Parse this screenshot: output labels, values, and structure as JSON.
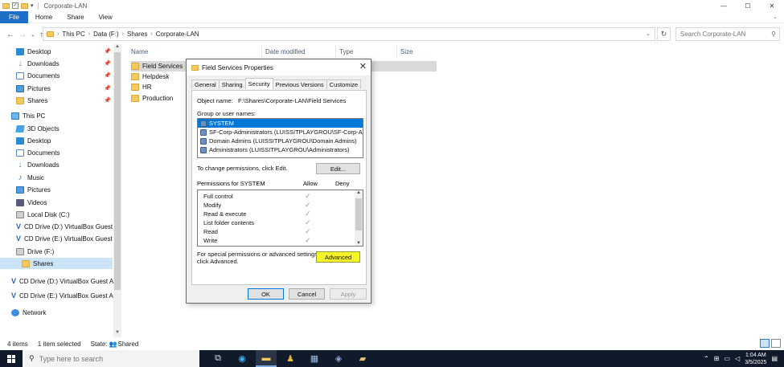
{
  "window": {
    "title": "Corporate-LAN",
    "controls": {
      "minimize": "—",
      "maximize": "☐",
      "close": "✕"
    }
  },
  "ribbon": {
    "tabs": [
      "File",
      "Home",
      "Share",
      "View"
    ],
    "expand_glyph": "⌄"
  },
  "nav_buttons": {
    "back": "←",
    "forward": "→",
    "recent": "⌄",
    "up": "↑"
  },
  "address": {
    "breadcrumbs": [
      "This PC",
      "Data (F:)",
      "Shares",
      "Corporate-LAN"
    ],
    "separator": "›"
  },
  "search": {
    "placeholder": "Search Corporate-LAN"
  },
  "navpane": {
    "quick_access": [
      {
        "label": "Desktop",
        "icon": "desktop-icon",
        "pinned": true
      },
      {
        "label": "Downloads",
        "icon": "downloads-icon",
        "pinned": true
      },
      {
        "label": "Documents",
        "icon": "documents-icon",
        "pinned": true
      },
      {
        "label": "Pictures",
        "icon": "pictures-icon",
        "pinned": true
      },
      {
        "label": "Shares",
        "icon": "folder-icon",
        "pinned": true
      }
    ],
    "this_pc": "This PC",
    "this_pc_items": [
      {
        "label": "3D Objects",
        "icon": "3d-objects-icon"
      },
      {
        "label": "Desktop",
        "icon": "desktop-icon"
      },
      {
        "label": "Documents",
        "icon": "documents-icon"
      },
      {
        "label": "Downloads",
        "icon": "downloads-icon"
      },
      {
        "label": "Music",
        "icon": "music-icon"
      },
      {
        "label": "Pictures",
        "icon": "pictures-icon"
      },
      {
        "label": "Videos",
        "icon": "videos-icon"
      },
      {
        "label": "Local Disk (C:)",
        "icon": "disk-icon"
      },
      {
        "label": "CD Drive (D:) VirtualBox Guest A",
        "icon": "virtualbox-cd-icon"
      },
      {
        "label": "CD Drive (E:) VirtualBox Guest A",
        "icon": "virtualbox-cd-icon"
      },
      {
        "label": "Drive (F:)",
        "icon": "disk-icon"
      },
      {
        "label": "Shares",
        "icon": "folder-icon"
      }
    ],
    "other_items": [
      {
        "label": "CD Drive (D:) VirtualBox Guest Ad",
        "icon": "virtualbox-cd-icon"
      },
      {
        "label": "CD Drive (E:) VirtualBox Guest Ad",
        "icon": "virtualbox-cd-icon"
      },
      {
        "label": "Network",
        "icon": "network-icon"
      }
    ]
  },
  "filelist": {
    "columns": [
      "Name",
      "Date modified",
      "Type",
      "Size"
    ],
    "items": [
      "Field Services",
      "Helpdesk",
      "HR",
      "Production"
    ]
  },
  "statusbar": {
    "items_count": "4 items",
    "selected": "1 item selected",
    "state_label": "State:",
    "state_value": "Shared"
  },
  "dialog": {
    "title": "Field Services Properties",
    "tabs": [
      "General",
      "Sharing",
      "Security",
      "Previous Versions",
      "Customize"
    ],
    "active_tab": "Security",
    "object_name_label": "Object name:",
    "object_name_value": "F:\\Shares\\Corporate-LAN\\Field Services",
    "group_label": "Group or user names:",
    "users": [
      "SYSTEM",
      "SF-Corp-Administrators (LUISSITPLAYGROU\\SF-Corp-Admi...",
      "Domain Admins (LUISSITPLAYGROU\\Domain Admins)",
      "Administrators (LUISSITPLAYGROU\\Administrators)"
    ],
    "change_hint": "To change permissions, click Edit.",
    "edit_button": "Edit...",
    "permissions_for": "Permissions for SYSTEM",
    "allow_header": "Allow",
    "deny_header": "Deny",
    "permissions": [
      {
        "name": "Full control",
        "allow": "✓"
      },
      {
        "name": "Modify",
        "allow": "✓"
      },
      {
        "name": "Read & execute",
        "allow": "✓"
      },
      {
        "name": "List folder contents",
        "allow": "✓"
      },
      {
        "name": "Read",
        "allow": "✓"
      },
      {
        "name": "Write",
        "allow": "✓"
      }
    ],
    "special_hint_1": "For special permissions or advanced settings,",
    "special_hint_2": "click Advanced.",
    "advanced_button": "Advanced",
    "ok_button": "OK",
    "cancel_button": "Cancel",
    "apply_button": "Apply",
    "close_glyph": "✕",
    "highlight_color": "#f7f32b"
  },
  "taskbar": {
    "search_placeholder": "Type here to search",
    "time": "1:04 AM",
    "date": "3/5/2025"
  }
}
